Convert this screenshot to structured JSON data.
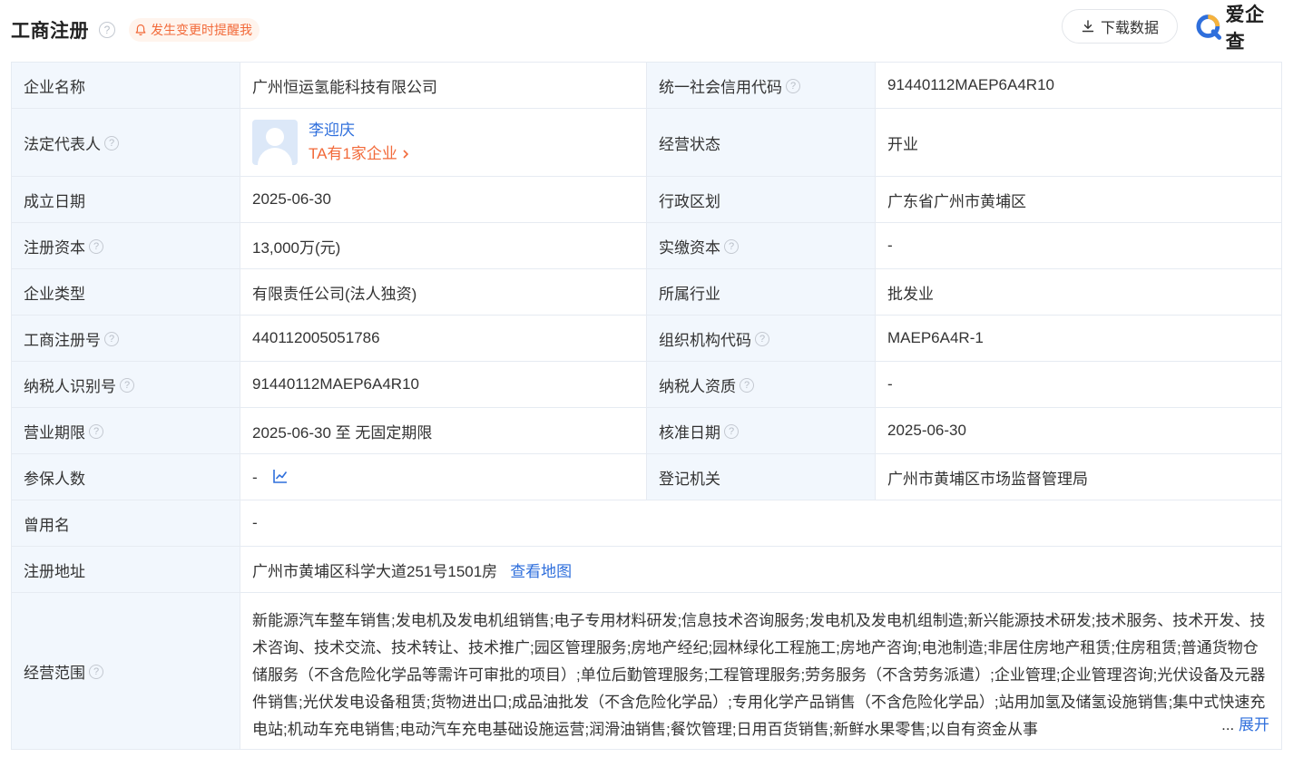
{
  "header": {
    "title": "工商注册",
    "help": "?",
    "remind_label": "发生变更时提醒我",
    "download_label": "下载数据",
    "logo_text": "爱企查"
  },
  "rows": {
    "company_name": {
      "label": "企业名称",
      "value": "广州恒运氢能科技有限公司"
    },
    "credit_code": {
      "label": "统一社会信用代码",
      "value": "91440112MAEP6A4R10"
    },
    "legal_rep": {
      "label": "法定代表人",
      "name": "李迎庆",
      "count": "TA有1家企业"
    },
    "status": {
      "label": "经营状态",
      "value": "开业"
    },
    "found_date": {
      "label": "成立日期",
      "value": "2025-06-30"
    },
    "region": {
      "label": "行政区划",
      "value": "广东省广州市黄埔区"
    },
    "reg_capital": {
      "label": "注册资本",
      "value": "13,000万(元)"
    },
    "paid_capital": {
      "label": "实缴资本",
      "value": "-"
    },
    "company_type": {
      "label": "企业类型",
      "value": "有限责任公司(法人独资)"
    },
    "industry": {
      "label": "所属行业",
      "value": "批发业"
    },
    "reg_no": {
      "label": "工商注册号",
      "value": "440112005051786"
    },
    "org_code": {
      "label": "组织机构代码",
      "value": "MAEP6A4R-1"
    },
    "taxpayer_id": {
      "label": "纳税人识别号",
      "value": "91440112MAEP6A4R10"
    },
    "taxpayer_qual": {
      "label": "纳税人资质",
      "value": "-"
    },
    "term": {
      "label": "营业期限",
      "value": "2025-06-30 至 无固定期限"
    },
    "approval_date": {
      "label": "核准日期",
      "value": "2025-06-30"
    },
    "insured": {
      "label": "参保人数",
      "value": "-"
    },
    "authority": {
      "label": "登记机关",
      "value": "广州市黄埔区市场监督管理局"
    },
    "former_name": {
      "label": "曾用名",
      "value": "-"
    },
    "address": {
      "label": "注册地址",
      "value": "广州市黄埔区科学大道251号1501房",
      "map_link": "查看地图"
    },
    "scope": {
      "label": "经营范围",
      "value": "新能源汽车整车销售;发电机及发电机组销售;电子专用材料研发;信息技术咨询服务;发电机及发电机组制造;新兴能源技术研发;技术服务、技术开发、技术咨询、技术交流、技术转让、技术推广;园区管理服务;房地产经纪;园林绿化工程施工;房地产咨询;电池制造;非居住房地产租赁;住房租赁;普通货物仓储服务（不含危险化学品等需许可审批的项目）;单位后勤管理服务;工程管理服务;劳务服务（不含劳务派遣）;企业管理;企业管理咨询;光伏设备及元器件销售;光伏发电设备租赁;货物进出口;成品油批发（不含危险化学品）;专用化学产品销售（不含危险化学品）;站用加氢及储氢设施销售;集中式快速充电站;机动车充电销售;电动汽车充电基础设施运营;润滑油销售;餐饮管理;日用百货销售;新鲜水果零售;以自有资金从事",
      "ellipsis": "...",
      "expand_label": "展开"
    }
  },
  "colors": {
    "label_bg": "#f2f7fd",
    "border": "#e6ebf2",
    "link": "#2f6fdc",
    "accent_orange": "#f26a3a"
  }
}
